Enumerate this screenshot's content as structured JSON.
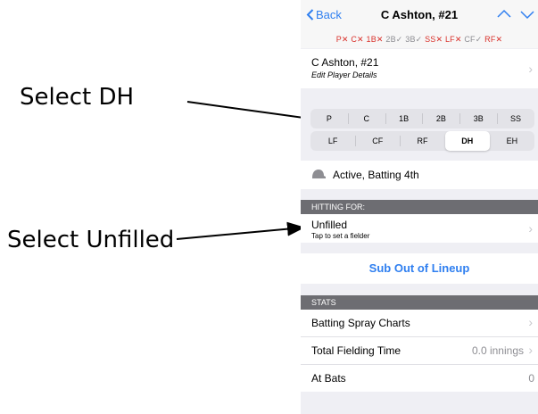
{
  "annotations": {
    "select_dh": "Select DH",
    "select_unfilled": "Select Unfilled"
  },
  "nav": {
    "back_label": "Back",
    "title": "C Ashton, #21",
    "prev_icon": "chevron-up-icon",
    "next_icon": "chevron-down-icon"
  },
  "position_legend": [
    {
      "text": "P✕",
      "filled": false
    },
    {
      "text": "C✕",
      "filled": false
    },
    {
      "text": "1B✕",
      "filled": false
    },
    {
      "text": "2B✓",
      "filled": true
    },
    {
      "text": "3B✓",
      "filled": true
    },
    {
      "text": "SS✕",
      "filled": false
    },
    {
      "text": "LF✕",
      "filled": false
    },
    {
      "text": "CF✓",
      "filled": true
    },
    {
      "text": "RF✕",
      "filled": false
    }
  ],
  "player": {
    "name": "C Ashton, #21",
    "edit_label": "Edit Player Details"
  },
  "positions_row1": [
    "P",
    "C",
    "1B",
    "2B",
    "3B",
    "SS"
  ],
  "positions_row2": [
    "LF",
    "CF",
    "RF",
    "DH",
    "EH"
  ],
  "selected_position": "DH",
  "status": {
    "icon": "batting-helmet-icon",
    "label": "Active, Batting 4th"
  },
  "hitting_for": {
    "header": "HITTING FOR:",
    "value": "Unfilled",
    "hint": "Tap to set a fielder"
  },
  "sub_out_label": "Sub Out of Lineup",
  "stats": {
    "header": "STATS",
    "spray_label": "Batting Spray Charts",
    "fielding_label": "Total Fielding Time",
    "fielding_value": "0.0 innings",
    "at_bats_label": "At Bats",
    "at_bats_value": "0"
  },
  "colors": {
    "accent": "#2f7ff0",
    "unfilled_red": "#d9312b",
    "section_header": "#6d6d72"
  }
}
